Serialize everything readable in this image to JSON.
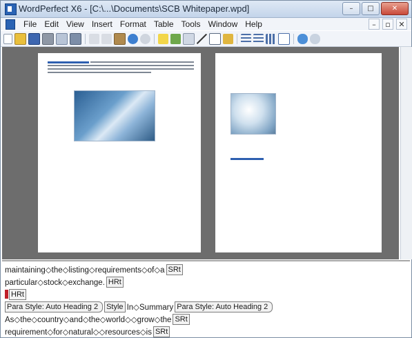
{
  "window": {
    "title": "WordPerfect X6 - [C:\\...\\Documents\\SCB Whitepaper.wpd]",
    "buttons": [
      "–",
      "□",
      "✕"
    ]
  },
  "menu": {
    "items": [
      "File",
      "Edit",
      "View",
      "Insert",
      "Format",
      "Table",
      "Tools",
      "Window",
      "Help"
    ],
    "mdi": [
      "–",
      "▫",
      "✕"
    ]
  },
  "reveal_codes": {
    "line1": {
      "text": "maintaining◇the◇listing◇requirements◇of◇a",
      "code": "SRt"
    },
    "line2": {
      "text": "particular◇stock◇exchange.",
      "code": "HRt"
    },
    "line3": {
      "code": "HRt"
    },
    "line4": {
      "code_open": "Para Style: Auto Heading 2",
      "code_style": "Style",
      "text": "In◇Summary",
      "code_close": "Para Style: Auto Heading 2"
    },
    "line5": {
      "text": "As◇the◇country◇and◇the◇world◇◇grow◇the",
      "code": "SRt"
    },
    "line6": {
      "text": "requirement◇for◇natural◇◇resources◇is",
      "code": "SRt"
    }
  },
  "colors": {
    "accent": "#2a63b4",
    "doc_bg": "#6d6d6d",
    "heading_text": "#2d5fb0",
    "code_cursor": "#c0202a"
  }
}
